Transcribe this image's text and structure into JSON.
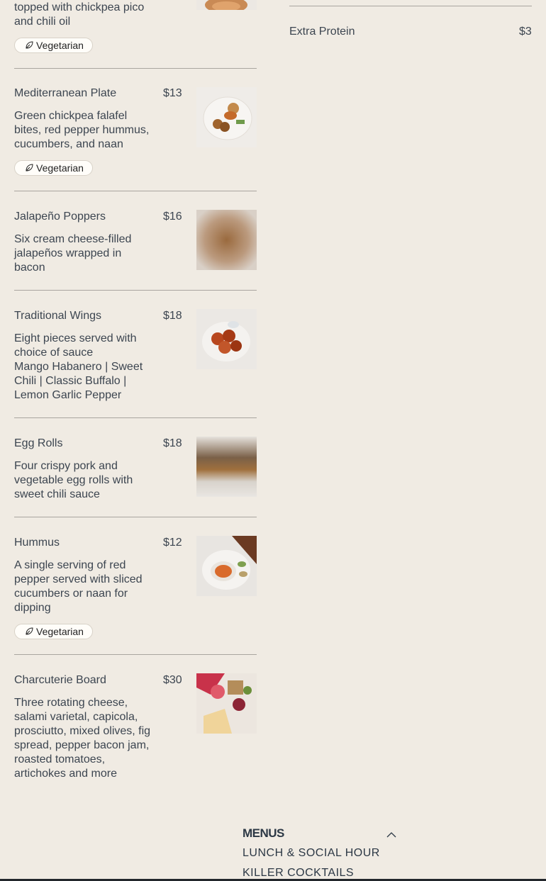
{
  "menu_items": [
    {
      "name": "",
      "price": "",
      "description": "topped with chickpea pico and chili oil",
      "tag": "Vegetarian"
    },
    {
      "name": "Mediterranean Plate",
      "price": "$13",
      "description": "Green chickpea falafel bites, red pepper hummus, cucumbers, and naan",
      "tag": "Vegetarian"
    },
    {
      "name": "Jalapeño Poppers",
      "price": "$16",
      "description": "Six cream cheese-filled jalapeños wrapped in bacon"
    },
    {
      "name": "Traditional Wings",
      "price": "$18",
      "description": "Eight pieces served with choice of sauce",
      "description2": "Mango Habanero | Sweet Chili | Classic Buffalo | Lemon Garlic Pepper"
    },
    {
      "name": "Egg Rolls",
      "price": "$18",
      "description": "Four crispy pork and vegetable egg rolls with sweet chili sauce"
    },
    {
      "name": "Hummus",
      "price": "$12",
      "description": "A single serving of red pepper served with sliced cucumbers or naan for dipping",
      "tag": "Vegetarian"
    },
    {
      "name": "Charcuterie Board",
      "price": "$30",
      "description": "Three rotating cheese, salami varietal, capicola, prosciutto, mixed olives, fig spread, pepper bacon jam, roasted tomatoes, artichokes and more"
    }
  ],
  "addons": [
    {
      "name": "Extra Protein",
      "price": "$3"
    }
  ],
  "footer": {
    "heading": "MENUS",
    "links": [
      "LUNCH & SOCIAL HOUR",
      "KILLER COCKTAILS"
    ]
  },
  "colors": {
    "background": "#f0ebe3",
    "text": "#3c4550",
    "divider": "#a9a59f"
  }
}
